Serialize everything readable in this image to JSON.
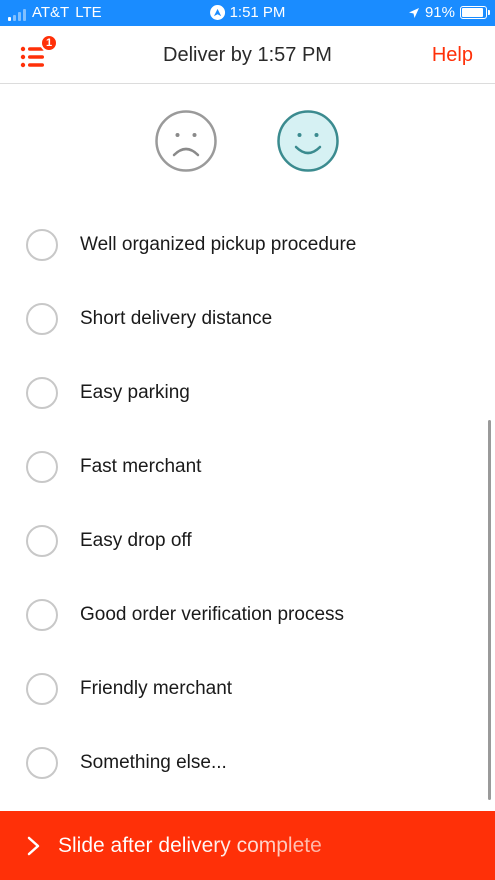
{
  "status_bar": {
    "carrier": "AT&T",
    "network": "LTE",
    "time": "1:51 PM",
    "battery": "91%",
    "battery_level": 0.91,
    "icons": [
      "signal-icon",
      "location-badge-icon",
      "location-arrow-icon",
      "battery-icon"
    ]
  },
  "header": {
    "title": "Deliver by 1:57 PM",
    "help_label": "Help",
    "menu_badge_count": "1",
    "menu_icon": "list-menu-icon"
  },
  "rating": {
    "faces": [
      "sad-face-icon",
      "happy-face-icon"
    ],
    "selected": "happy"
  },
  "options": [
    {
      "label": "Well organized pickup procedure"
    },
    {
      "label": "Short delivery distance"
    },
    {
      "label": "Easy parking"
    },
    {
      "label": "Fast merchant"
    },
    {
      "label": "Easy drop off"
    },
    {
      "label": "Good order verification process"
    },
    {
      "label": "Friendly merchant"
    },
    {
      "label": "Something else..."
    }
  ],
  "footer": {
    "slide_label": "Slide after delivery complete",
    "icon": "chevron-right-icon"
  },
  "colors": {
    "status_bar_bg": "#1a8cff",
    "accent_red": "#ff3008",
    "happy_face_fill": "#d6f1f3",
    "happy_face_stroke": "#3b8b8f",
    "sad_face_stroke": "#9a9a9a"
  }
}
